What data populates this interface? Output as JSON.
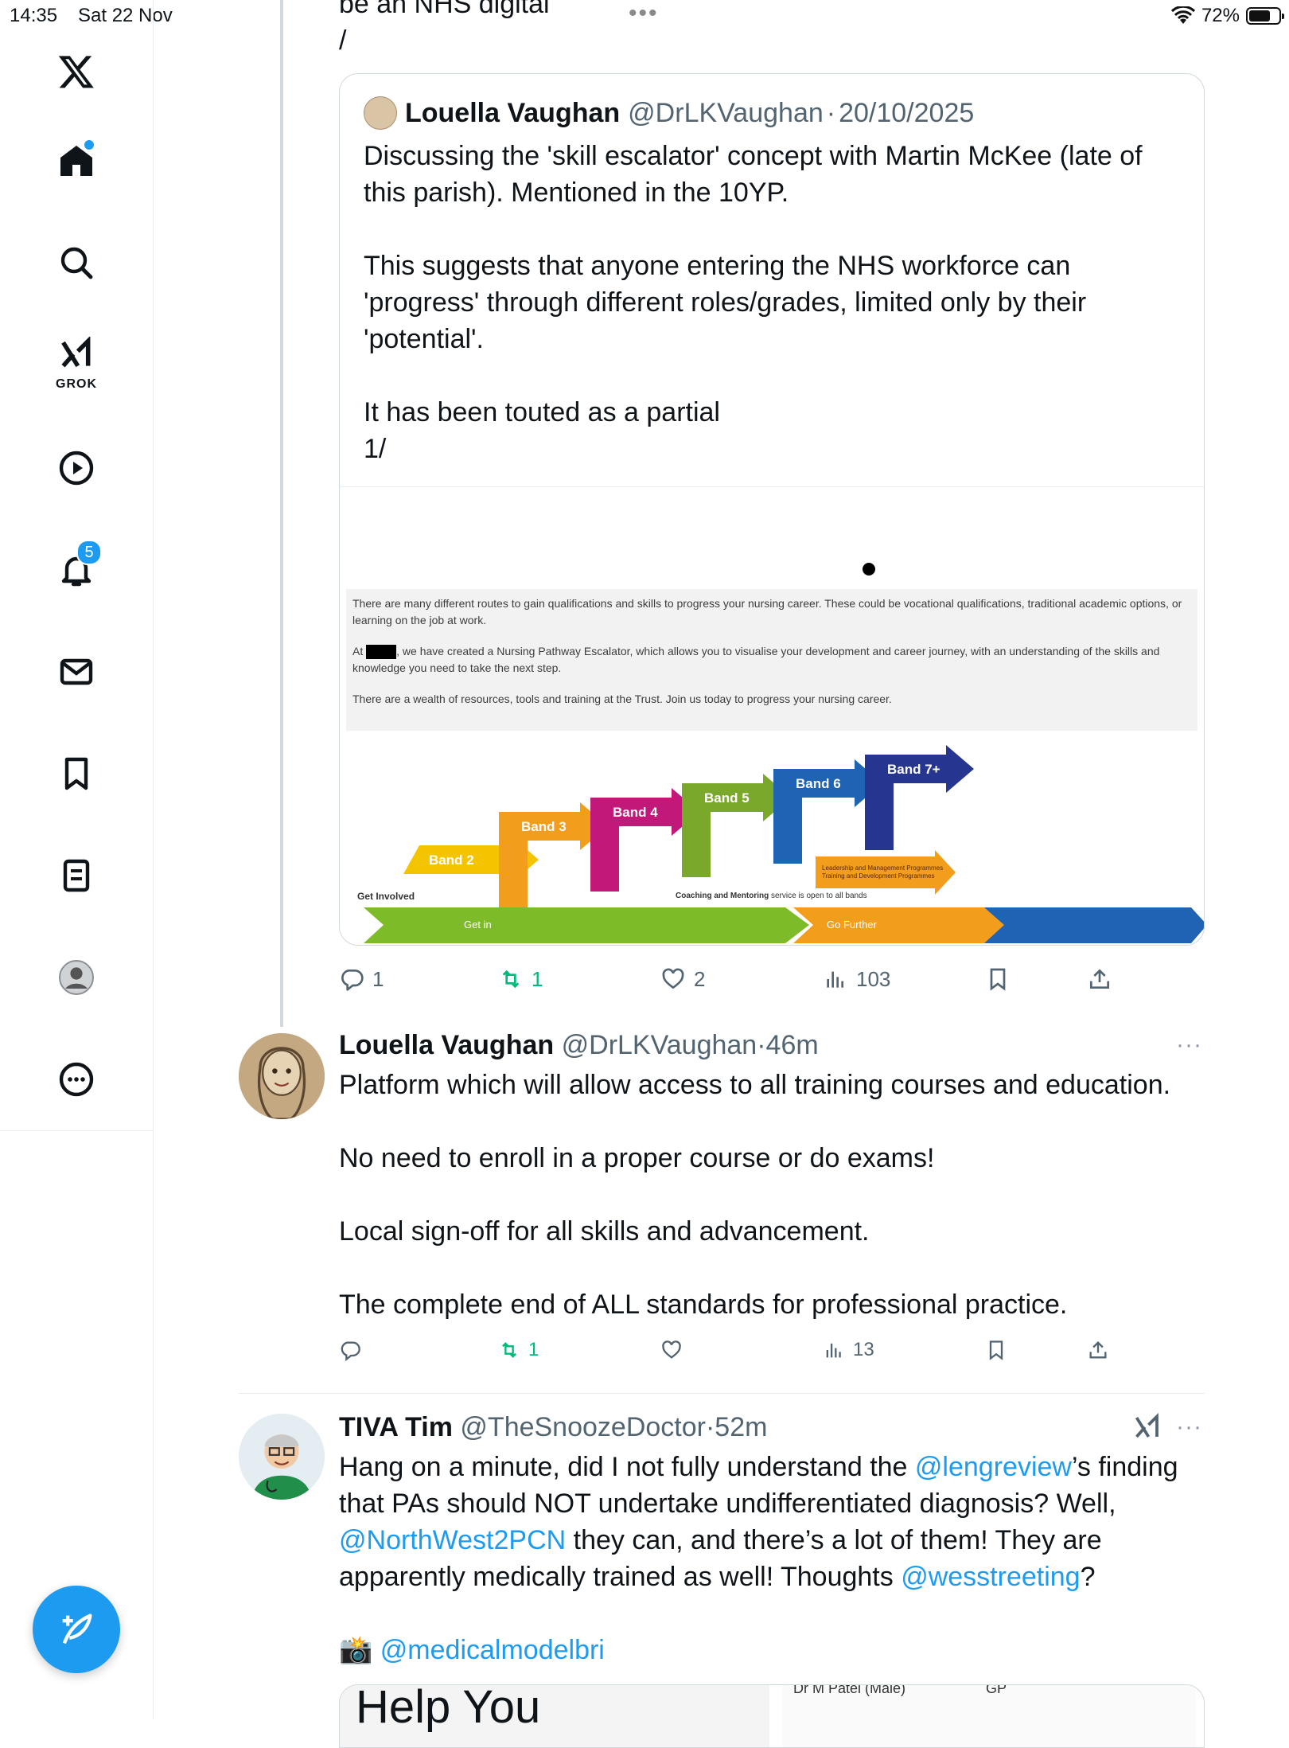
{
  "status_bar": {
    "time": "14:35",
    "date": "Sat 22 Nov",
    "battery_pct_label": "72%",
    "battery_level": 0.72
  },
  "sidebar": {
    "grok_label": "GROK",
    "notifications_count": "5"
  },
  "parent_tweet_tail": {
    "line1": "be an NHS digital",
    "line2": "/"
  },
  "quoted_tweet": {
    "name": "Louella Vaughan",
    "handle": "@DrLKVaughan",
    "sep": "·",
    "date": "20/10/2025",
    "paragraphs": [
      "Discussing the 'skill escalator' concept with Martin McKee (late of this parish). Mentioned in the 10YP.",
      "This suggests that anyone entering the NHS workforce can 'progress' through different roles/grades, limited only by their 'potential'.",
      "It has been touted as a partial\n1/"
    ],
    "image": {
      "text_lines": [
        "There are many different routes to gain qualifications and skills to progress your nursing career. These could be vocational qualifications, traditional academic options, or learning on the job at work.",
        "we have created a Nursing Pathway Escalator, which allows you to visualise your development and career journey, with an understanding of the skills and knowledge you need to take the next step.",
        "There are a wealth of resources, tools and training at the Trust. Join us today to progress your nursing career."
      ],
      "at_prefix": "At",
      "bands": [
        "Band 2",
        "Band 3",
        "Band 4",
        "Band 5",
        "Band 6",
        "Band 7+"
      ],
      "get_involved": "Get Involved",
      "coaching_bold": "Coaching and Mentoring",
      "coaching_rest": " service is open to all bands",
      "leadership_line1": "Leadership and Management Programmes",
      "leadership_line2": "Training and Development Programmes",
      "get_in": "Get in",
      "go_further": "Go Further"
    },
    "colors": {
      "band2": "#f5c400",
      "band3": "#f29d1b",
      "band4": "#c2187a",
      "band5": "#7aa82a",
      "band6": "#1f63b5",
      "band7": "#26358f"
    }
  },
  "tweet1_actions": {
    "replies": "1",
    "reposts": "1",
    "likes": "2",
    "views": "103"
  },
  "tweet2": {
    "name": "Louella Vaughan",
    "handle": "@DrLKVaughan",
    "sep": "·",
    "time": "46m",
    "more": "···",
    "paragraphs": [
      "Platform which will allow access to all training courses and education.",
      "No need to enroll in a proper course or do exams!",
      "Local sign-off for all skills and advancement.",
      "The complete end of ALL standards for professional practice."
    ],
    "actions": {
      "reposts": "1",
      "views": "13"
    }
  },
  "tweet3": {
    "name": "TIVA Tim",
    "handle": "@TheSnoozeDoctor",
    "sep": "·",
    "time": "52m",
    "more": "···",
    "text_a": "Hang on a minute, did I not fully understand the ",
    "mention_lengreview": "@lengreview",
    "text_b": "’s finding that PAs should NOT undertake undifferentiated diagnosis? Well, ",
    "mention_northwest": "@NorthWest2PCN",
    "text_c": " they can, and there’s a lot of them! They are apparently medically trained as well! Thoughts ",
    "mention_wes": "@wesstreeting",
    "text_d": "?",
    "camera_emoji": "📸",
    "mention_medical": "@medicalmodelbri",
    "media_left": "Help You",
    "media_right_name": "Dr M Patel (Male)",
    "media_right_role": "GP"
  }
}
